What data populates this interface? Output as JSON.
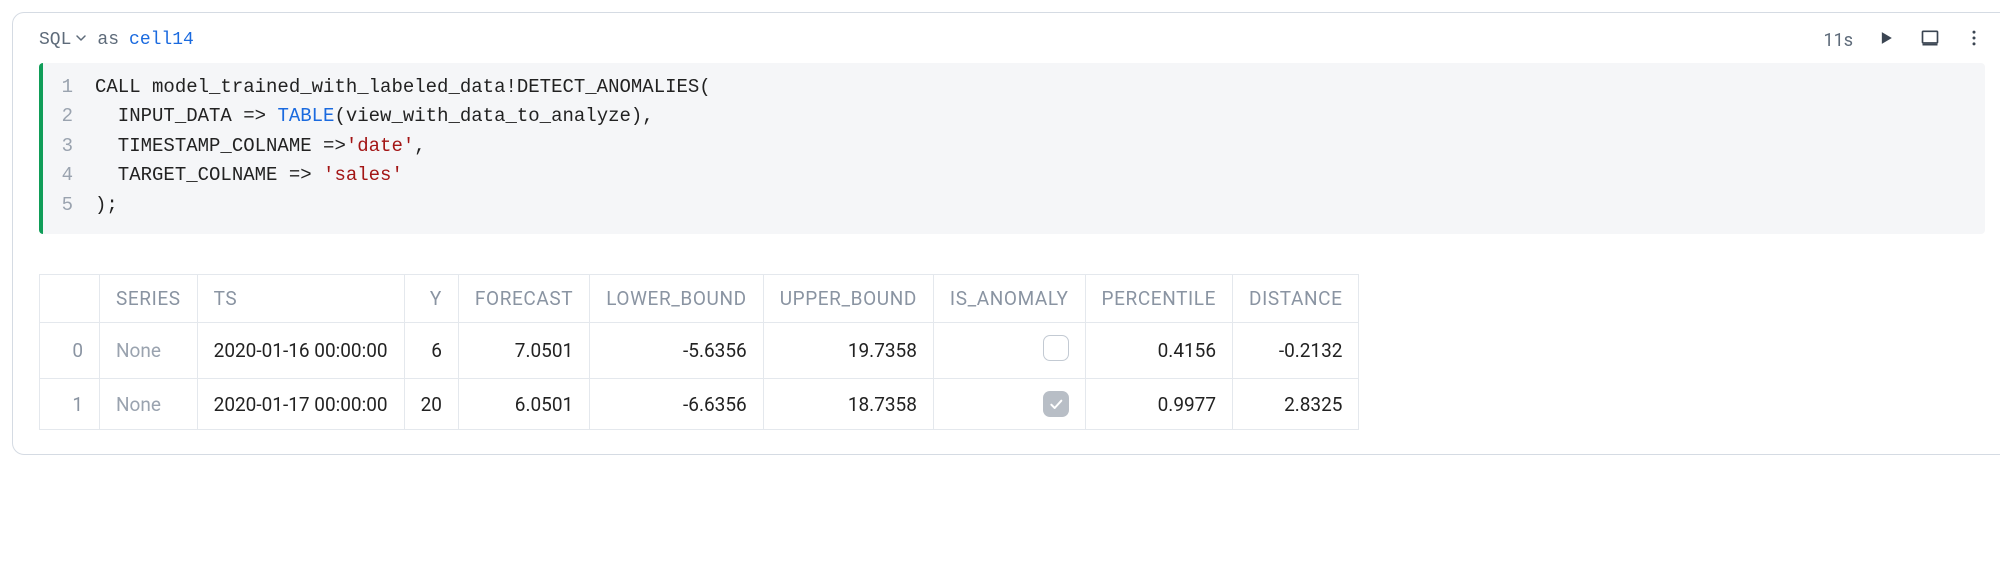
{
  "header": {
    "language": "SQL",
    "as_label": "as",
    "cell_name": "cell14",
    "elapsed": "11s"
  },
  "code": {
    "lines": [
      {
        "n": "1",
        "segments": [
          {
            "t": "CALL model_trained_with_labeled_data!DETECT_ANOMALIES("
          }
        ]
      },
      {
        "n": "2",
        "segments": [
          {
            "t": "  INPUT_DATA => "
          },
          {
            "t": "TABLE",
            "cls": "tok-kw"
          },
          {
            "t": "(view_with_data_to_analyze),"
          }
        ]
      },
      {
        "n": "3",
        "segments": [
          {
            "t": "  TIMESTAMP_COLNAME =>"
          },
          {
            "t": "'date'",
            "cls": "tok-str"
          },
          {
            "t": ","
          }
        ]
      },
      {
        "n": "4",
        "segments": [
          {
            "t": "  TARGET_COLNAME => "
          },
          {
            "t": "'sales'",
            "cls": "tok-str"
          }
        ]
      },
      {
        "n": "5",
        "segments": [
          {
            "t": ");"
          }
        ]
      }
    ]
  },
  "table": {
    "columns": [
      "SERIES",
      "TS",
      "Y",
      "FORECAST",
      "LOWER_BOUND",
      "UPPER_BOUND",
      "IS_ANOMALY",
      "PERCENTILE",
      "DISTANCE"
    ],
    "rows": [
      {
        "idx": "0",
        "series": "None",
        "ts": "2020-01-16 00:00:00",
        "y": "6",
        "forecast": "7.0501",
        "lower": "-5.6356",
        "upper": "19.7358",
        "is_anomaly": false,
        "percentile": "0.4156",
        "distance": "-0.2132"
      },
      {
        "idx": "1",
        "series": "None",
        "ts": "2020-01-17 00:00:00",
        "y": "20",
        "forecast": "6.0501",
        "lower": "-6.6356",
        "upper": "18.7358",
        "is_anomaly": true,
        "percentile": "0.9977",
        "distance": "2.8325"
      }
    ]
  }
}
